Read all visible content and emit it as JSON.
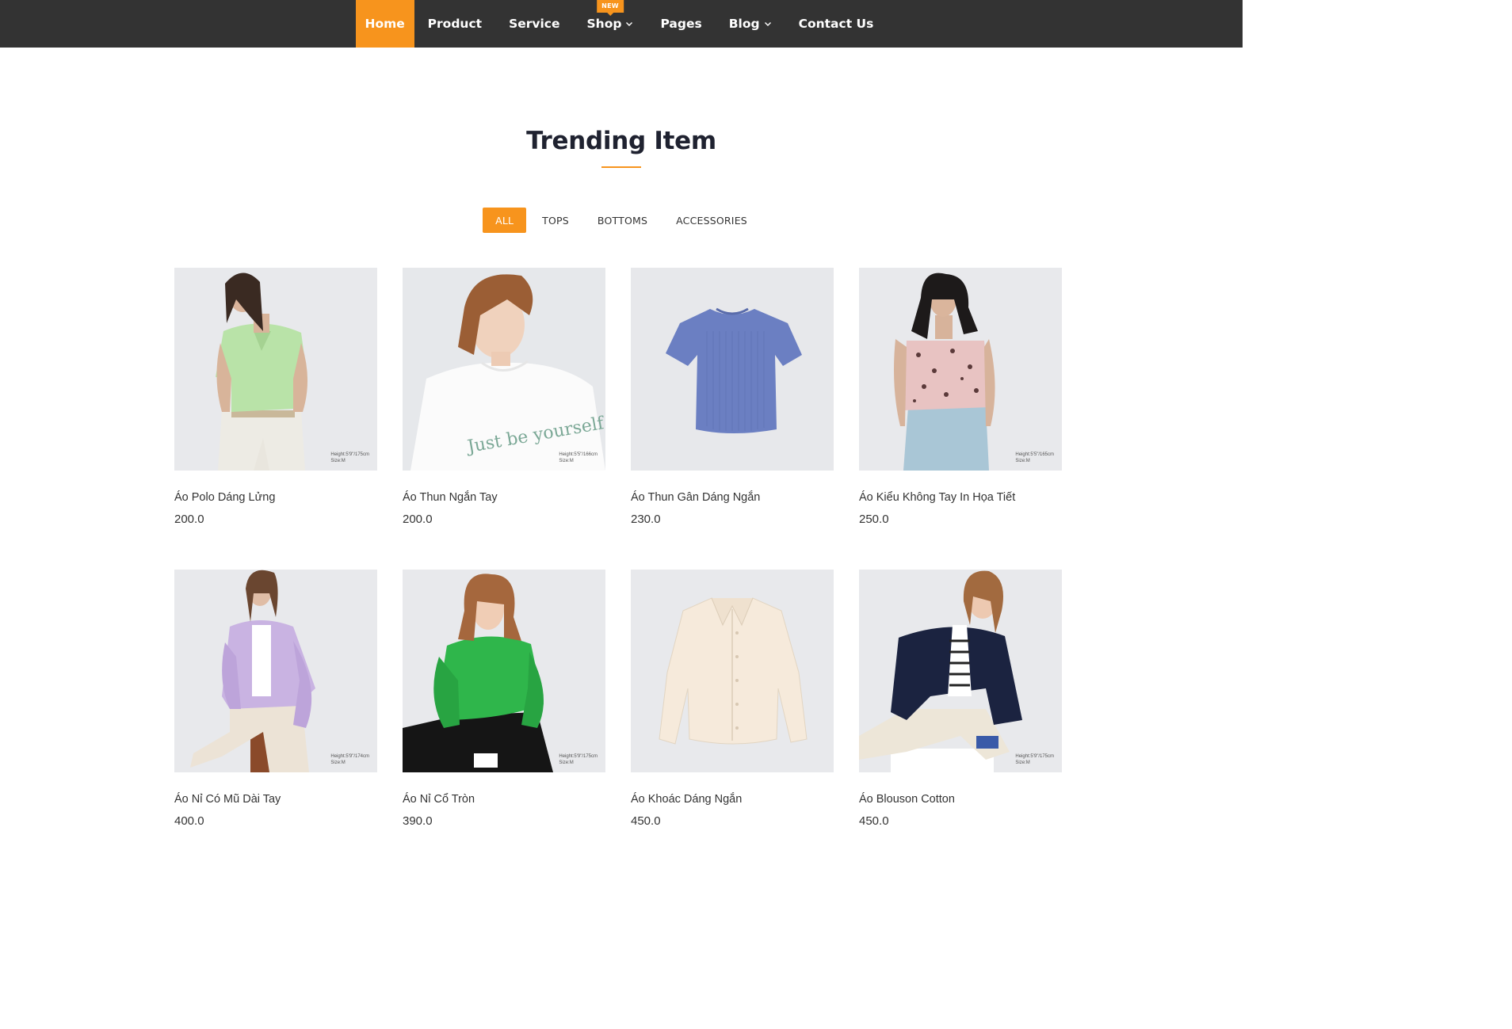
{
  "nav": {
    "items": [
      {
        "label": "Home",
        "active": true,
        "dropdown": false
      },
      {
        "label": "Product",
        "active": false,
        "dropdown": false
      },
      {
        "label": "Service",
        "active": false,
        "dropdown": false
      },
      {
        "label": "Shop",
        "active": false,
        "dropdown": true,
        "badge": "NEW"
      },
      {
        "label": "Pages",
        "active": false,
        "dropdown": false
      },
      {
        "label": "Blog",
        "active": false,
        "dropdown": true
      },
      {
        "label": "Contact Us",
        "active": false,
        "dropdown": false
      }
    ]
  },
  "section": {
    "title": "Trending Item"
  },
  "filters": [
    {
      "label": "ALL",
      "active": true
    },
    {
      "label": "TOPS",
      "active": false
    },
    {
      "label": "BOTTOMS",
      "active": false
    },
    {
      "label": "ACCESSORIES",
      "active": false
    }
  ],
  "products": [
    {
      "name": "Áo Polo Dáng Lửng",
      "price": "200.0",
      "note1": "Height:5'9\"/175cm",
      "note2": "Size:M"
    },
    {
      "name": "Áo Thun Ngắn Tay",
      "price": "200.0",
      "note1": "Height:5'5\"/166cm",
      "note2": "Size:M"
    },
    {
      "name": "Áo Thun Gân Dáng Ngắn",
      "price": "230.0",
      "note1": "",
      "note2": ""
    },
    {
      "name": "Áo Kiểu Không Tay In Họa Tiết",
      "price": "250.0",
      "note1": "Height:5'5\"/165cm",
      "note2": "Size:M"
    },
    {
      "name": "Áo Nỉ Có Mũ Dài Tay",
      "price": "400.0",
      "note1": "Height:5'9\"/174cm",
      "note2": "Size:M"
    },
    {
      "name": "Áo Nỉ Cổ Tròn",
      "price": "390.0",
      "note1": "Height:5'9\"/175cm",
      "note2": "Size:M"
    },
    {
      "name": "Áo Khoác Dáng Ngắn",
      "price": "450.0",
      "note1": "",
      "note2": ""
    },
    {
      "name": "Áo Blouson Cotton",
      "price": "450.0",
      "note1": "Height:5'9\"/175cm",
      "note2": "Size:M"
    }
  ],
  "colors": {
    "accent": "#f7941d",
    "navbar": "#333333",
    "title": "#1f2230"
  }
}
